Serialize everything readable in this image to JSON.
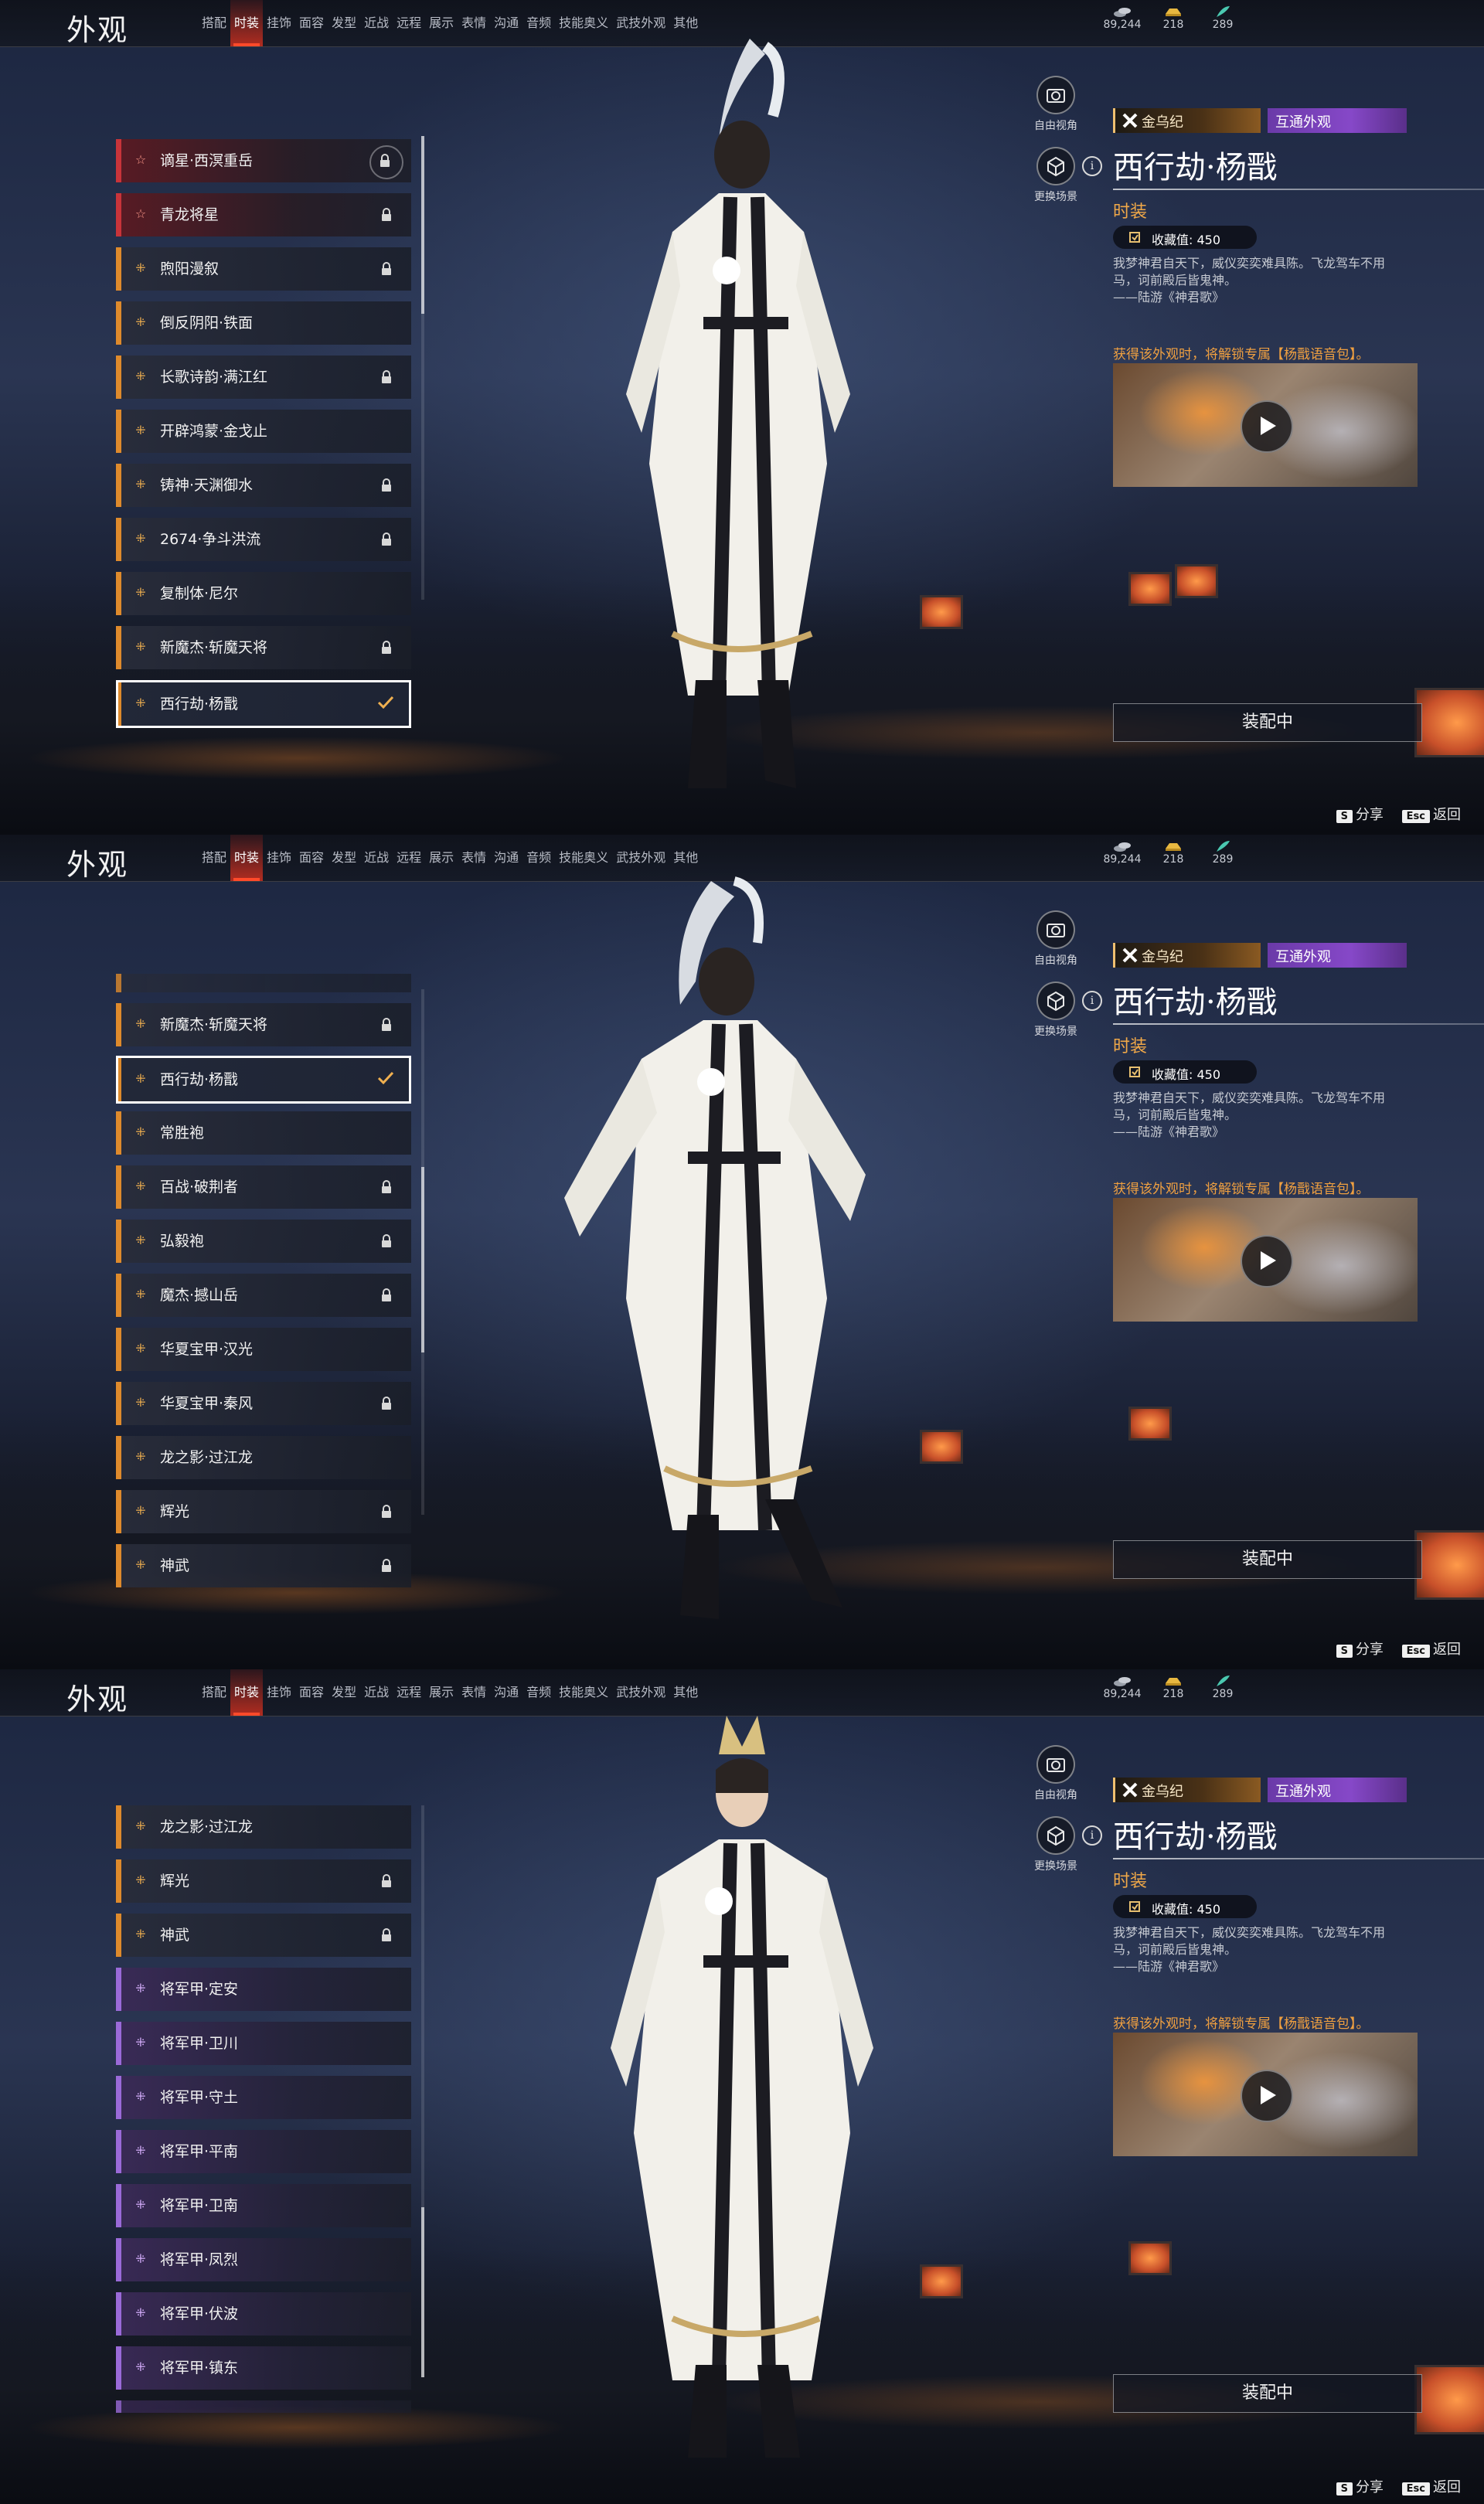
{
  "app": {
    "title": "外观"
  },
  "tabs": [
    "搭配",
    "时装",
    "挂饰",
    "面容",
    "发型",
    "近战",
    "远程",
    "展示",
    "表情",
    "沟通",
    "音频",
    "技能奥义",
    "武技外观",
    "其他"
  ],
  "active_tab": "时装",
  "currencies": [
    {
      "icon": "coin-stack-icon",
      "value": "89,244"
    },
    {
      "icon": "gold-ingot-icon",
      "value": "218"
    },
    {
      "icon": "jade-feather-icon",
      "value": "289"
    }
  ],
  "camera_controls": {
    "free_view_label": "自由视角",
    "change_scene_label": "更换场景"
  },
  "detail": {
    "series": "金乌纪",
    "interop_tag": "互通外观",
    "item_title": "西行劫·杨戬",
    "category": "时装",
    "collection_label": "收藏值: 450",
    "poem_line1": "我梦神君自天下，威仪奕奕难具陈。飞龙驾车不用",
    "poem_line2": "马，诃前殿后皆鬼神。",
    "poem_source": "——陆游《神君歌》",
    "unlock_note": "获得该外观时，将解锁专属【杨戬语音包】。",
    "equip_label": "装配中"
  },
  "hotkeys": {
    "share_key": "S",
    "share_label": "分享",
    "back_key": "Esc",
    "back_label": "返回"
  },
  "panel1_list": [
    {
      "name": "谪星·西溟重岳",
      "rarity": "red",
      "status": "locked-ring"
    },
    {
      "name": "青龙将星",
      "rarity": "red",
      "status": "locked"
    },
    {
      "name": "煦阳漫叙",
      "rarity": "orange",
      "status": "locked"
    },
    {
      "name": "倒反阴阳·铁面",
      "rarity": "orange",
      "status": "none"
    },
    {
      "name": "长歌诗韵·满江红",
      "rarity": "orange",
      "status": "locked"
    },
    {
      "name": "开辟鸿蒙·金戈止",
      "rarity": "orange",
      "status": "none"
    },
    {
      "name": "铸神·天渊御水",
      "rarity": "orange",
      "status": "locked"
    },
    {
      "name": "2674·争斗洪流",
      "rarity": "orange",
      "status": "locked"
    },
    {
      "name": "复制体·尼尔",
      "rarity": "orange",
      "status": "none"
    },
    {
      "name": "新魔杰·斩魔天将",
      "rarity": "orange",
      "status": "locked"
    },
    {
      "name": "西行劫·杨戬",
      "rarity": "orange",
      "status": "equipped"
    }
  ],
  "panel2_list": [
    {
      "name": "新魔杰·斩魔天将",
      "rarity": "orange",
      "status": "locked"
    },
    {
      "name": "西行劫·杨戬",
      "rarity": "orange",
      "status": "equipped"
    },
    {
      "name": "常胜袍",
      "rarity": "orange",
      "status": "none"
    },
    {
      "name": "百战·破荆者",
      "rarity": "orange",
      "status": "locked"
    },
    {
      "name": "弘毅袍",
      "rarity": "orange",
      "status": "locked"
    },
    {
      "name": "魔杰·撼山岳",
      "rarity": "orange",
      "status": "locked"
    },
    {
      "name": "华夏宝甲·汉光",
      "rarity": "orange",
      "status": "none"
    },
    {
      "name": "华夏宝甲·秦风",
      "rarity": "orange",
      "status": "locked"
    },
    {
      "name": "龙之影·过江龙",
      "rarity": "orange",
      "status": "none"
    },
    {
      "name": "辉光",
      "rarity": "orange",
      "status": "locked"
    },
    {
      "name": "神武",
      "rarity": "orange",
      "status": "locked"
    }
  ],
  "panel3_list": [
    {
      "name": "龙之影·过江龙",
      "rarity": "orange",
      "status": "none"
    },
    {
      "name": "辉光",
      "rarity": "orange",
      "status": "locked"
    },
    {
      "name": "神武",
      "rarity": "orange",
      "status": "locked"
    },
    {
      "name": "将军甲·定安",
      "rarity": "purple",
      "status": "none"
    },
    {
      "name": "将军甲·卫川",
      "rarity": "purple",
      "status": "none"
    },
    {
      "name": "将军甲·守土",
      "rarity": "purple",
      "status": "none"
    },
    {
      "name": "将军甲·平南",
      "rarity": "purple",
      "status": "none"
    },
    {
      "name": "将军甲·卫南",
      "rarity": "purple",
      "status": "none"
    },
    {
      "name": "将军甲·凤烈",
      "rarity": "purple",
      "status": "none"
    },
    {
      "name": "将军甲·伏波",
      "rarity": "purple",
      "status": "none"
    },
    {
      "name": "将军甲·镇东",
      "rarity": "purple",
      "status": "none"
    }
  ],
  "colors": {
    "accent_red": "#ff4a2a",
    "rarity_red": "#c8343a",
    "rarity_orange": "#de8a2c",
    "rarity_purple": "#9a6ad8",
    "category_orange": "#f0a848",
    "interop_purple": "#8648c8"
  }
}
